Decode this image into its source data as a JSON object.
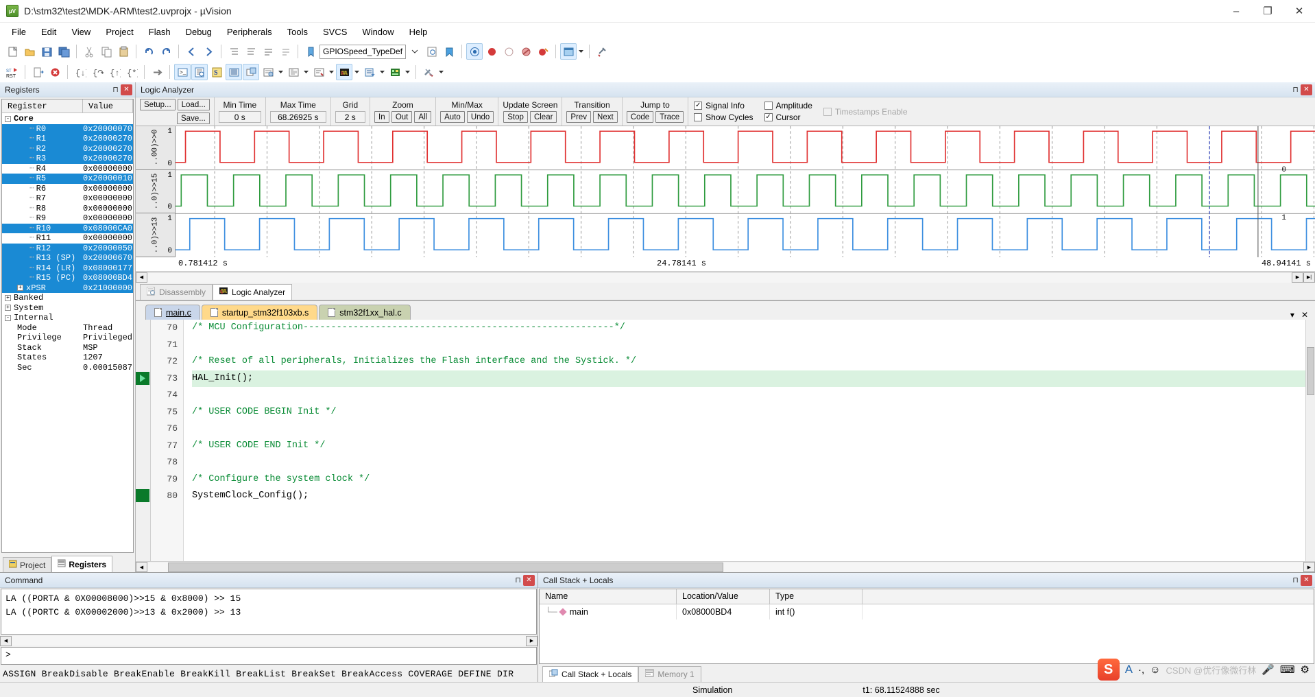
{
  "window": {
    "title": "D:\\stm32\\test2\\MDK-ARM\\test2.uvprojx - µVision",
    "minimize": "–",
    "maximize": "❐",
    "close": "✕"
  },
  "menu": [
    "File",
    "Edit",
    "View",
    "Project",
    "Flash",
    "Debug",
    "Peripherals",
    "Tools",
    "SVCS",
    "Window",
    "Help"
  ],
  "toolbar2": {
    "symbol_combo": "GPIOSpeed_TypeDef"
  },
  "registers_panel": {
    "title": "Registers",
    "columns": [
      "Register",
      "Value"
    ],
    "rows": [
      {
        "label": "Core",
        "value": "",
        "indent": 0,
        "expander": "-",
        "selected": false,
        "bold": true
      },
      {
        "label": "R0",
        "value": "0x20000070",
        "indent": 2,
        "expander": "",
        "selected": true
      },
      {
        "label": "R1",
        "value": "0x20000270",
        "indent": 2,
        "expander": "",
        "selected": true
      },
      {
        "label": "R2",
        "value": "0x20000270",
        "indent": 2,
        "expander": "",
        "selected": true
      },
      {
        "label": "R3",
        "value": "0x20000270",
        "indent": 2,
        "expander": "",
        "selected": true
      },
      {
        "label": "R4",
        "value": "0x00000000",
        "indent": 2,
        "expander": "",
        "selected": false
      },
      {
        "label": "R5",
        "value": "0x20000010",
        "indent": 2,
        "expander": "",
        "selected": true
      },
      {
        "label": "R6",
        "value": "0x00000000",
        "indent": 2,
        "expander": "",
        "selected": false
      },
      {
        "label": "R7",
        "value": "0x00000000",
        "indent": 2,
        "expander": "",
        "selected": false
      },
      {
        "label": "R8",
        "value": "0x00000000",
        "indent": 2,
        "expander": "",
        "selected": false
      },
      {
        "label": "R9",
        "value": "0x00000000",
        "indent": 2,
        "expander": "",
        "selected": false
      },
      {
        "label": "R10",
        "value": "0x08000CA0",
        "indent": 2,
        "expander": "",
        "selected": true
      },
      {
        "label": "R11",
        "value": "0x00000000",
        "indent": 2,
        "expander": "",
        "selected": false
      },
      {
        "label": "R12",
        "value": "0x20000050",
        "indent": 2,
        "expander": "",
        "selected": true
      },
      {
        "label": "R13 (SP)",
        "value": "0x20000670",
        "indent": 2,
        "expander": "",
        "selected": true
      },
      {
        "label": "R14 (LR)",
        "value": "0x08000177",
        "indent": 2,
        "expander": "",
        "selected": true
      },
      {
        "label": "R15 (PC)",
        "value": "0x08000BD4",
        "indent": 2,
        "expander": "",
        "selected": true
      },
      {
        "label": "xPSR",
        "value": "0x21000000",
        "indent": 1,
        "expander": "+",
        "selected": true
      },
      {
        "label": "Banked",
        "value": "",
        "indent": 0,
        "expander": "+",
        "selected": false
      },
      {
        "label": "System",
        "value": "",
        "indent": 0,
        "expander": "+",
        "selected": false
      },
      {
        "label": "Internal",
        "value": "",
        "indent": 0,
        "expander": "-",
        "selected": false
      },
      {
        "label": "Mode",
        "value": "Thread",
        "indent": 1,
        "expander": "",
        "selected": false
      },
      {
        "label": "Privilege",
        "value": "Privileged",
        "indent": 1,
        "expander": "",
        "selected": false
      },
      {
        "label": "Stack",
        "value": "MSP",
        "indent": 1,
        "expander": "",
        "selected": false
      },
      {
        "label": "States",
        "value": "1207",
        "indent": 1,
        "expander": "",
        "selected": false
      },
      {
        "label": "Sec",
        "value": "0.00015087",
        "indent": 1,
        "expander": "",
        "selected": false
      }
    ],
    "tabs": [
      {
        "label": "Project",
        "active": false
      },
      {
        "label": "Registers",
        "active": true
      }
    ]
  },
  "logic_analyzer": {
    "title": "Logic Analyzer",
    "buttons": {
      "setup": "Setup...",
      "load": "Load...",
      "save": "Save..."
    },
    "fields": [
      {
        "label": "Min Time",
        "value": "0 s"
      },
      {
        "label": "Max Time",
        "value": "68.26925 s"
      },
      {
        "label": "Grid",
        "value": "2 s"
      }
    ],
    "groups": [
      {
        "label": "Zoom",
        "buttons": [
          "In",
          "Out",
          "All"
        ]
      },
      {
        "label": "Min/Max",
        "buttons": [
          "Auto",
          "Undo"
        ]
      },
      {
        "label": "Update Screen",
        "buttons": [
          "Stop",
          "Clear"
        ]
      },
      {
        "label": "Transition",
        "buttons": [
          "Prev",
          "Next"
        ]
      },
      {
        "label": "Jump to",
        "buttons": [
          "Code",
          "Trace"
        ]
      }
    ],
    "checkboxes": [
      {
        "label": "Signal Info",
        "checked": true,
        "disabled": false
      },
      {
        "label": "Amplitude",
        "checked": false,
        "disabled": false
      },
      {
        "label": "Timestamps Enable",
        "checked": false,
        "disabled": true
      },
      {
        "label": "Show Cycles",
        "checked": false,
        "disabled": false
      },
      {
        "label": "Cursor",
        "checked": true,
        "disabled": false
      }
    ],
    "signals": [
      {
        "label": "..00)>>0",
        "max": "1",
        "min": "0",
        "color": "#e03030"
      },
      {
        "label": "..0)>>15",
        "max": "1",
        "min": "0",
        "color": "#2e9b3e"
      },
      {
        "label": "..0)>>13",
        "max": "1",
        "min": "0",
        "color": "#3d8fe0"
      }
    ],
    "cursor_markers": [
      "0",
      "1",
      "1"
    ],
    "time_left": "0.781412 s",
    "time_center": "24.78141 s",
    "time_right": "48.94141 s",
    "dock_tabs": [
      {
        "label": "Disassembly",
        "active": false
      },
      {
        "label": "Logic Analyzer",
        "active": true
      }
    ]
  },
  "editor": {
    "tabs": [
      {
        "label": "main.c",
        "active": true
      },
      {
        "label": "startup_stm32f103xb.s",
        "active": false
      },
      {
        "label": "stm32f1xx_hal.c",
        "active": false
      }
    ],
    "lines": [
      {
        "no": "70",
        "text": "/* MCU Configuration--------------------------------------------------------*/",
        "comment": true,
        "current": false,
        "bp": ""
      },
      {
        "no": "71",
        "text": "",
        "comment": false,
        "current": false,
        "bp": ""
      },
      {
        "no": "72",
        "text": "/* Reset of all peripherals, Initializes the Flash interface and the Systick. */",
        "comment": true,
        "current": false,
        "bp": ""
      },
      {
        "no": "73",
        "text": "HAL_Init();",
        "comment": false,
        "current": true,
        "bp": "arrow"
      },
      {
        "no": "74",
        "text": "",
        "comment": false,
        "current": false,
        "bp": ""
      },
      {
        "no": "75",
        "text": "/* USER CODE BEGIN Init */",
        "comment": true,
        "current": false,
        "bp": ""
      },
      {
        "no": "76",
        "text": "",
        "comment": false,
        "current": false,
        "bp": ""
      },
      {
        "no": "77",
        "text": "/* USER CODE END Init */",
        "comment": true,
        "current": false,
        "bp": ""
      },
      {
        "no": "78",
        "text": "",
        "comment": false,
        "current": false,
        "bp": ""
      },
      {
        "no": "79",
        "text": "/* Configure the system clock */",
        "comment": true,
        "current": false,
        "bp": ""
      },
      {
        "no": "80",
        "text": "SystemClock_Config();",
        "comment": false,
        "current": false,
        "bp": "green"
      }
    ]
  },
  "command_panel": {
    "title": "Command",
    "output_lines": [
      "LA ((PORTA & 0X00008000)>>15 & 0x8000) >> 15",
      "LA ((PORTC & 0X00002000)>>13 & 0x2000) >> 13"
    ],
    "prompt": ">",
    "keys_line": "ASSIGN BreakDisable BreakEnable BreakKill BreakList BreakSet BreakAccess COVERAGE DEFINE DIR"
  },
  "callstack_panel": {
    "title": "Call Stack + Locals",
    "columns": [
      "Name",
      "Location/Value",
      "Type"
    ],
    "rows": [
      {
        "name": "main",
        "location": "0x08000BD4",
        "type": "int f()"
      }
    ],
    "tabs": [
      {
        "label": "Call Stack + Locals",
        "active": true
      },
      {
        "label": "Memory 1",
        "active": false
      }
    ]
  },
  "statusbar": {
    "mode": "Simulation",
    "time": "t1: 68.11524888 sec"
  },
  "colors": {
    "selection_blue": "#1a8ad4",
    "signal_red": "#e03030",
    "signal_green": "#2e9b3e",
    "signal_blue": "#3d8fe0",
    "current_line": "#daf2e0",
    "comment_green": "#0a8c36"
  }
}
